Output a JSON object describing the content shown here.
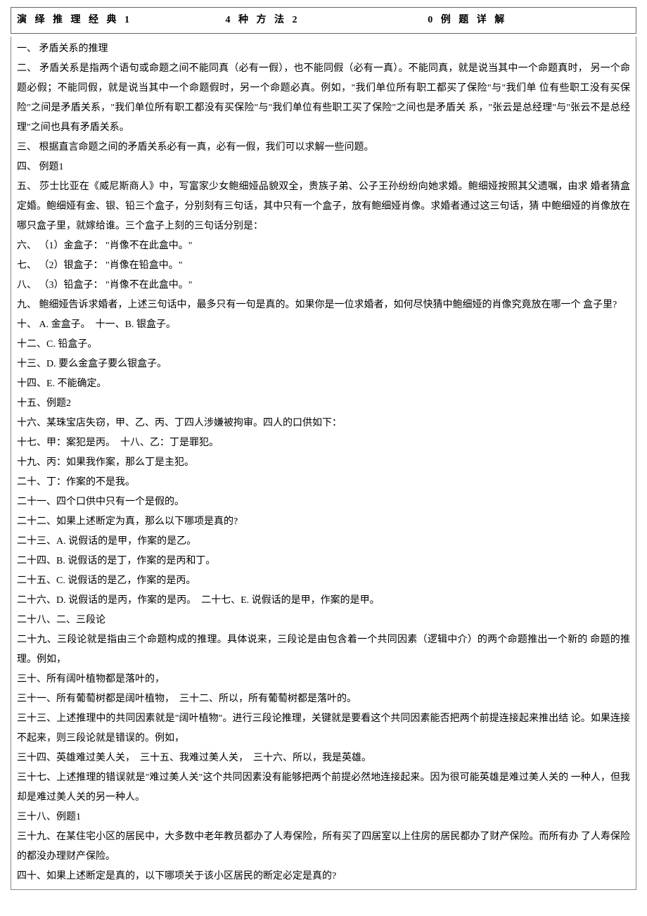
{
  "header": {
    "col1": "演 绎 推 理 经 典 1",
    "col2": "4 种 方 法 2",
    "col3": "0 例 题 详 解"
  },
  "lines": [
    "一、 矛盾关系的推理",
    "二、 矛盾关系是指两个语句或命题之间不能同真（必有一假），也不能同假（必有一真）。不能同真，就是说当其中一个命题真时， 另一个命题必假；不能同假，就是说当其中一个命题假时，另一个命题必真。例如，\"我们单位所有职工都买了保险\"与\"我们单 位有些职工没有买保险\"之间是矛盾关系，\"我们单位所有职工都没有买保险\"与\"我们单位有些职工买了保险\"之间也是矛盾关 系，\"张云是总经理\"与\"张云不是总经理\"之间也具有矛盾关系。",
    "三、 根据直言命题之间的矛盾关系必有一真，必有一假，我们可以求解一些问题。",
    "四、 例题1",
    "五、 莎士比亚在《威尼斯商人》中，写富家少女鲍细娅品貌双全，贵族子弟、公子王孙纷纷向她求婚。鲍细娅按照其父遗嘱，由求 婚者猜盒定婚。鲍细娅有金、银、铅三个盒子，分别刻有三句话，其中只有一个盒子，放有鲍细娅肖像。求婚者通过这三句话，猜 中鲍细娅的肖像放在哪只盒子里，就嫁给谁。三个盒子上刻的三句话分别是：",
    "六、 （1）金盒子： \"肖像不在此盒中。\"",
    "七、 （2）银盒子： \"肖像在铅盒中。\"",
    "八、 （3）铅盒子： \"肖像不在此盒中。\"",
    "九、 鲍细娅告诉求婚者，上述三句话中，最多只有一句是真的。如果你是一位求婚者，如何尽快猜中鲍细娅的肖像究竟放在哪一个 盒子里?",
    "十、 A. 金盒子。　十一、B. 银盒子。",
    "十二、C. 铅盒子。",
    "十三、D. 要么金盒子要么银盒子。",
    "十四、E. 不能确定。",
    "十五、例题2",
    "十六、某珠宝店失窃，甲、乙、丙、丁四人涉嫌被拘审。四人的口供如下：",
    "十七、甲：案犯是丙。　十八、乙：丁是罪犯。",
    "十九、丙：如果我作案，那么丁是主犯。",
    "二十、丁：作案的不是我。",
    "二十一、四个口供中只有一个是假的。",
    "二十二、如果上述断定为真，那么以下哪项是真的?",
    "二十三、A. 说假话的是甲，作案的是乙。",
    "二十四、B. 说假话的是丁，作案的是丙和丁。",
    "二十五、C. 说假话的是乙，作案的是丙。",
    "二十六、D. 说假话的是丙，作案的是丙。　二十七、E. 说假话的是甲，作案的是甲。",
    "二十八、二、三段论",
    "二十九、三段论就是指由三个命题构成的推理。具体说来，三段论是由包含着一个共同因素（逻辑中介）的两个命题推出一个新的 命题的推理。例如，",
    "三十、所有阔叶植物都是落叶的，",
    "三十一、所有葡萄树都是阔叶植物，　三十二、所以，所有葡萄树都是落叶的。",
    "三十三、上述推理中的共同因素就是\"阔叶植物\"。进行三段论推理，关键就是要看这个共同因素能否把两个前提连接起来推出结 论。如果连接不起来，则三段论就是错误的。例如，",
    "三十四、英雄难过美人关，　三十五、我难过美人关，　三十六、所以，我是英雄。",
    "三十七、上述推理的错误就是\"难过美人关\"这个共同因素没有能够把两个前提必然地连接起来。因为很可能英雄是难过美人关的 一种人，但我却是难过美人关的另一种人。",
    "三十八、例题1",
    "三十九、在某住宅小区的居民中，大多数中老年教员都办了人寿保险，所有买了四居室以上住房的居民都办了财产保险。而所有办 了人寿保险的都没办理财产保险。",
    "四十、如果上述断定是真的，以下哪项关于该小区居民的断定必定是真的?"
  ]
}
